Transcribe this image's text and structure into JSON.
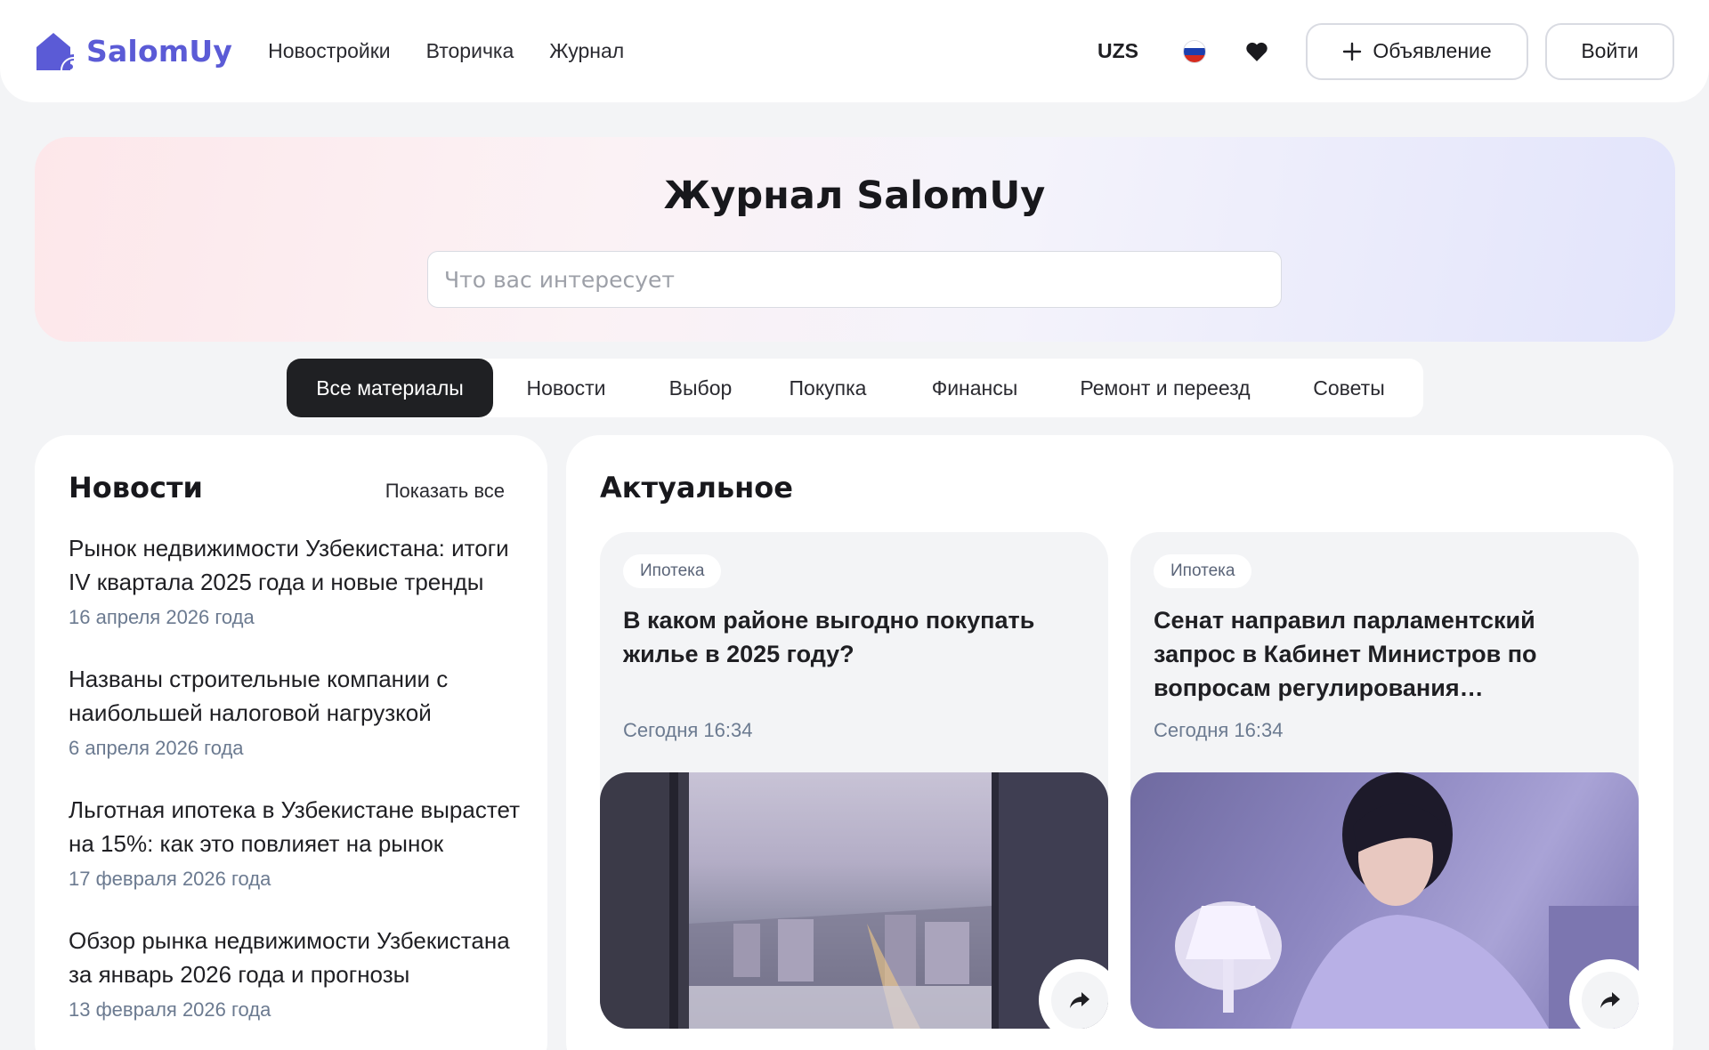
{
  "header": {
    "logo_text": "SalomUy",
    "nav": [
      "Новостройки",
      "Вторичка",
      "Журнал"
    ],
    "currency": "UZS",
    "ad_button": "Объявление",
    "login_button": "Войти"
  },
  "hero": {
    "title": "Журнал SalomUy",
    "search_placeholder": "Что вас интересует"
  },
  "tabs": [
    "Все материалы",
    "Новости",
    "Выбор",
    "Покупка",
    "Финансы",
    "Ремонт и переезд",
    "Советы"
  ],
  "news": {
    "title": "Новости",
    "show_all": "Показать все",
    "items": [
      {
        "title": "Рынок недвижимости Узбекистана: итоги IV квартала 2025 года и новые тренды",
        "date": "16 апреля 2026 года"
      },
      {
        "title": "Названы строительные компании с наибольшей налоговой нагрузкой",
        "date": "6 апреля 2026 года"
      },
      {
        "title": "Льготная ипотека в Узбекистане вырастет на 15%: как это повлияет на рынок",
        "date": "17 февраля 2026 года"
      },
      {
        "title": "Обзор рынка недвижимости Узбекистана за январь 2026 года и прогнозы",
        "date": "13 февраля 2026 года"
      }
    ]
  },
  "featured": {
    "title": "Актуальное",
    "articles": [
      {
        "tag": "Ипотека",
        "title": "В каком районе выгодно покупать жилье в 2025 году?",
        "time": "Сегодня 16:34"
      },
      {
        "tag": "Ипотека",
        "title": "Сенат направил парламентский запрос в Кабинет Министров по вопросам регулирования строительства",
        "time": "Сегодня 16:34"
      }
    ]
  },
  "colors": {
    "brand": "#5b5bd6",
    "active_tab": "#1f2023",
    "date_text": "#6b7a90"
  }
}
